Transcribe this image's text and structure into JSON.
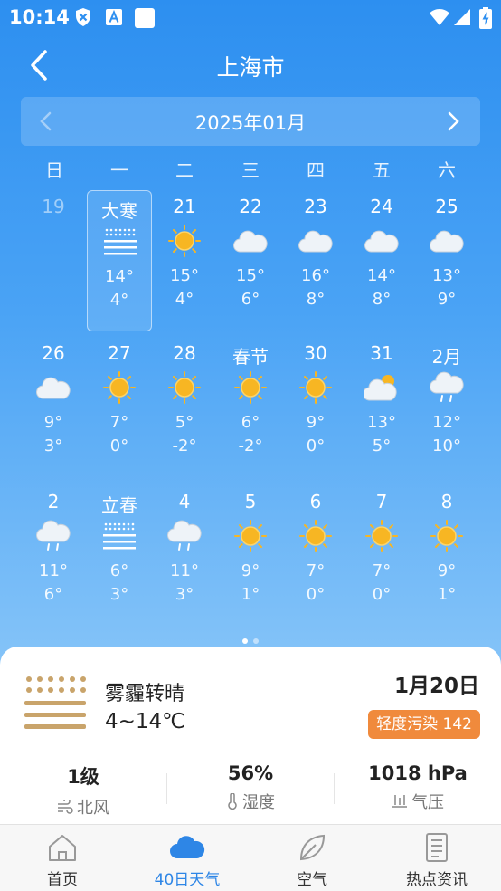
{
  "status_bar": {
    "time": "10:14"
  },
  "header": {
    "city": "上海市"
  },
  "calendar": {
    "month_label": "2025年01月",
    "weekdays": [
      "日",
      "一",
      "二",
      "三",
      "四",
      "五",
      "六"
    ],
    "days": [
      {
        "label": "19",
        "icon": "",
        "hi": "",
        "lo": "",
        "faded": true
      },
      {
        "label": "大寒",
        "icon": "haze",
        "hi": "14°",
        "lo": "4°",
        "selected": true
      },
      {
        "label": "21",
        "icon": "sunny",
        "hi": "15°",
        "lo": "4°"
      },
      {
        "label": "22",
        "icon": "cloudy",
        "hi": "15°",
        "lo": "6°"
      },
      {
        "label": "23",
        "icon": "cloudy",
        "hi": "16°",
        "lo": "8°"
      },
      {
        "label": "24",
        "icon": "cloudy",
        "hi": "14°",
        "lo": "8°"
      },
      {
        "label": "25",
        "icon": "cloudy",
        "hi": "13°",
        "lo": "9°"
      },
      {
        "label": "26",
        "icon": "cloudy",
        "hi": "9°",
        "lo": "3°"
      },
      {
        "label": "27",
        "icon": "sunny",
        "hi": "7°",
        "lo": "0°"
      },
      {
        "label": "28",
        "icon": "sunny",
        "hi": "5°",
        "lo": "-2°"
      },
      {
        "label": "春节",
        "icon": "sunny",
        "hi": "6°",
        "lo": "-2°"
      },
      {
        "label": "30",
        "icon": "sunny",
        "hi": "9°",
        "lo": "0°"
      },
      {
        "label": "31",
        "icon": "partly-cloudy",
        "hi": "13°",
        "lo": "5°"
      },
      {
        "label": "2月",
        "icon": "rain",
        "hi": "12°",
        "lo": "10°"
      },
      {
        "label": "2",
        "icon": "rain",
        "hi": "11°",
        "lo": "6°"
      },
      {
        "label": "立春",
        "icon": "haze",
        "hi": "6°",
        "lo": "3°"
      },
      {
        "label": "4",
        "icon": "rain",
        "hi": "11°",
        "lo": "3°"
      },
      {
        "label": "5",
        "icon": "sunny",
        "hi": "9°",
        "lo": "1°"
      },
      {
        "label": "6",
        "icon": "sunny",
        "hi": "7°",
        "lo": "0°"
      },
      {
        "label": "7",
        "icon": "sunny",
        "hi": "7°",
        "lo": "0°"
      },
      {
        "label": "8",
        "icon": "sunny",
        "hi": "9°",
        "lo": "1°"
      }
    ]
  },
  "detail": {
    "condition": "雾霾转晴",
    "temp_range": "4~14℃",
    "date": "1月20日",
    "aqi": "轻度污染 142",
    "stats": [
      {
        "value": "1级",
        "label": "北风",
        "icon": "wind-icon"
      },
      {
        "value": "56%",
        "label": "湿度",
        "icon": "thermometer-icon"
      },
      {
        "value": "1018 hPa",
        "label": "气压",
        "icon": "pressure-icon"
      }
    ]
  },
  "nav": [
    {
      "label": "首页",
      "icon": "home-icon",
      "active": false
    },
    {
      "label": "40日天气",
      "icon": "cloud-icon",
      "active": true
    },
    {
      "label": "空气",
      "icon": "leaf-icon",
      "active": false
    },
    {
      "label": "热点资讯",
      "icon": "news-icon",
      "active": false
    }
  ],
  "colors": {
    "accent": "#2e86e6",
    "aqi_badge": "#f08a3c",
    "sun": "#f7b623"
  }
}
